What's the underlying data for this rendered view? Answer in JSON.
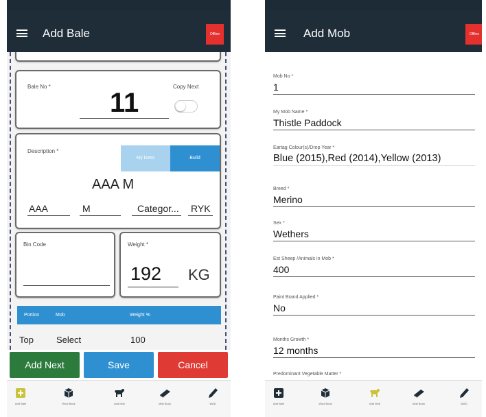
{
  "left": {
    "title": "Add Bale",
    "offline_badge": "Offline",
    "bale": {
      "label": "Bale No *",
      "number": "11",
      "copy_next_label": "Copy Next"
    },
    "description": {
      "label": "Description *",
      "my_desc_btn": "My Desc",
      "build_btn": "Build",
      "value": "AAA M",
      "fields": [
        "AAA",
        "M",
        "Categor...",
        "RYK"
      ]
    },
    "bin_code": {
      "label": "Bin Code",
      "value": ""
    },
    "weight": {
      "label": "Weight *",
      "value": "192",
      "unit": "KG"
    },
    "table": {
      "headers": [
        "Portion",
        "Mob",
        "Weight %"
      ],
      "row": [
        "Top",
        "Select",
        "100"
      ]
    },
    "actions": {
      "add_next": "Add Next",
      "save": "Save",
      "cancel": "Cancel"
    }
  },
  "right": {
    "title": "Add Mob",
    "offline_badge": "Offline",
    "fields": [
      {
        "label": "Mob No *",
        "value": "1"
      },
      {
        "label": "My Mob Name *",
        "value": "Thistle Paddock"
      },
      {
        "label": "Eartag Colour(s)/Drop Year *",
        "value": "Blue (2015),Red (2014),Yellow (2013)"
      },
      {
        "label": "Breed *",
        "value": "Merino"
      },
      {
        "label": "Sex *",
        "value": "Wethers"
      },
      {
        "label": "Est Sheep /Animals in Mob *",
        "value": "400"
      },
      {
        "label": "Paint Brand Applied *",
        "value": "No"
      },
      {
        "label": "Months Growth *",
        "value": "12 months"
      },
      {
        "label": "Predominant Vegetable Matter *",
        "value": ""
      }
    ]
  },
  "tabs": [
    {
      "label": "Add Bale",
      "icon": "plus-square-icon"
    },
    {
      "label": "Wool Book",
      "icon": "cube-icon"
    },
    {
      "label": "Add Mob",
      "icon": "sheep-icon"
    },
    {
      "label": "Mob Book",
      "icon": "book-icon"
    },
    {
      "label": "WAD",
      "icon": "pencil-icon"
    }
  ],
  "colors": {
    "appbar": "#1f2d38",
    "accent_blue": "#2f90d1",
    "add_next_green": "#2c7a3c",
    "cancel_red": "#e03a35",
    "offline_red": "#e5312e",
    "active_tab_yellow": "#c9c23a"
  }
}
